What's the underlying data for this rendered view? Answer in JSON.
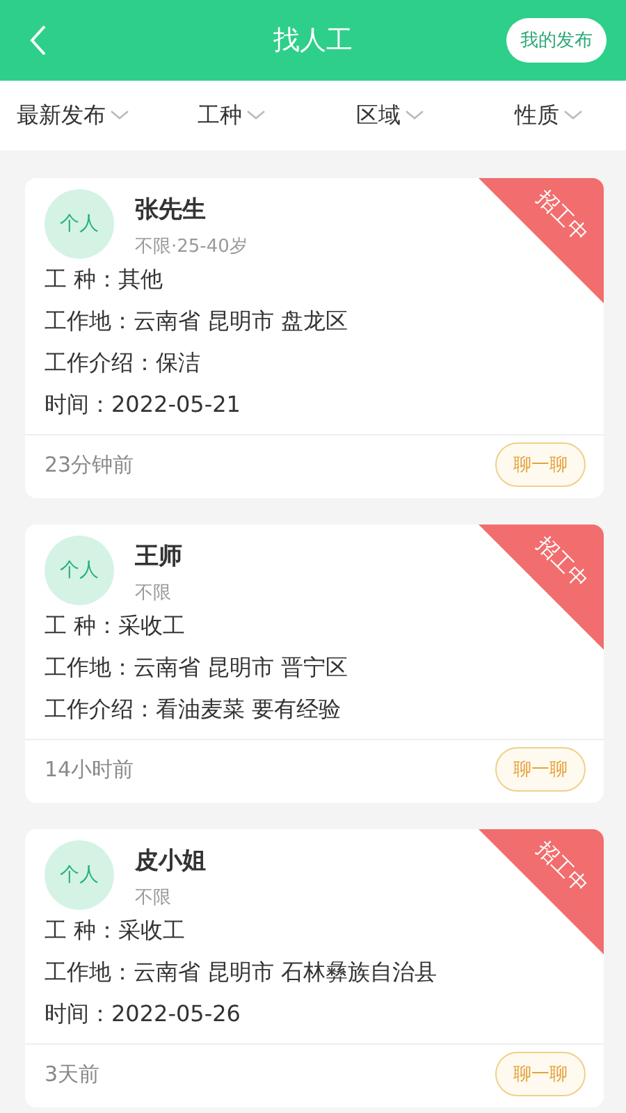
{
  "header": {
    "title": "找人工",
    "action": "我的发布"
  },
  "filters": [
    {
      "label": "最新发布"
    },
    {
      "label": "工种"
    },
    {
      "label": "区域"
    },
    {
      "label": "性质"
    }
  ],
  "posts": [
    {
      "avatar": "个人",
      "name": "张先生",
      "meta": "不限·25-40岁",
      "status": "招工中",
      "lines": [
        "工 种：其他",
        "工作地：云南省 昆明市 盘龙区",
        "工作介绍：保洁",
        "时间：2022-05-21"
      ],
      "ago": "23分钟前",
      "chat": "聊一聊"
    },
    {
      "avatar": "个人",
      "name": "王师",
      "meta": "不限",
      "status": "招工中",
      "lines": [
        "工 种：采收工",
        "工作地：云南省 昆明市 晋宁区",
        "工作介绍：看油麦菜 要有经验"
      ],
      "ago": "14小时前",
      "chat": "聊一聊"
    },
    {
      "avatar": "个人",
      "name": "皮小姐",
      "meta": "不限",
      "status": "招工中",
      "lines": [
        "工 种：采收工",
        "工作地：云南省 昆明市 石林彝族自治县",
        "时间：2022-05-26"
      ],
      "ago": "3天前",
      "chat": "聊一聊"
    }
  ]
}
